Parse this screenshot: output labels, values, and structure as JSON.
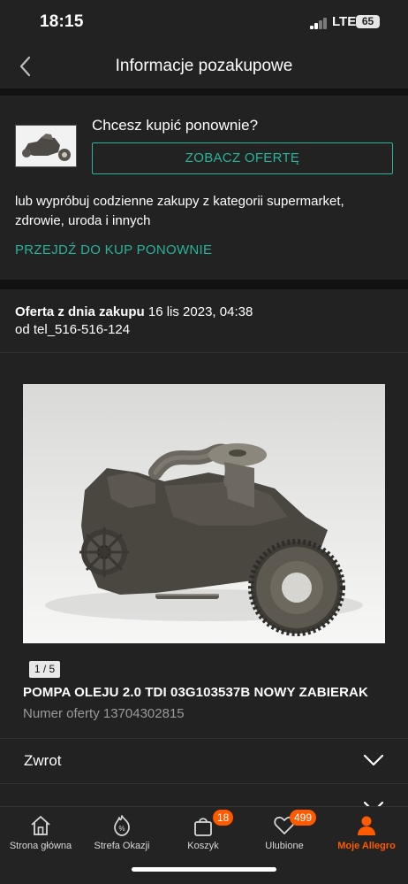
{
  "status_bar": {
    "time": "18:15",
    "network": "LTE",
    "battery": "65"
  },
  "header": {
    "title": "Informacje pozakupowe"
  },
  "buy_again": {
    "title": "Chcesz kupić ponownie?",
    "button_label": "ZOBACZ OFERTĘ",
    "description": "lub wypróbuj codzienne zakupy z kategorii supermarket, zdrowie, uroda i innych",
    "link_label": "PRZEJDŹ DO KUP PONOWNIE"
  },
  "offer_info": {
    "date_label": "Oferta z dnia zakupu",
    "date_value": "16 lis 2023, 04:38",
    "seller_line": "od tel_516-516-124"
  },
  "product": {
    "image_counter": "1 / 5",
    "title": "POMPA OLEJU 2.0 TDI 03G103537B NOWY ZABIERAK",
    "offer_number": "Numer oferty 13704302815"
  },
  "sections": [
    {
      "label": "Zwrot"
    }
  ],
  "bottom_nav": {
    "items": [
      {
        "label": "Strona główna",
        "icon": "home-icon"
      },
      {
        "label": "Strefa Okazji",
        "icon": "percent-badge-icon"
      },
      {
        "label": "Koszyk",
        "icon": "cart-icon",
        "badge": "18"
      },
      {
        "label": "Ulubione",
        "icon": "heart-icon",
        "badge": "499"
      },
      {
        "label": "Moje Allegro",
        "icon": "user-icon"
      }
    ]
  },
  "colors": {
    "accent": "#28b39b",
    "active": "#ff5a00",
    "background": "#1c1c1e",
    "card": "#222222"
  }
}
